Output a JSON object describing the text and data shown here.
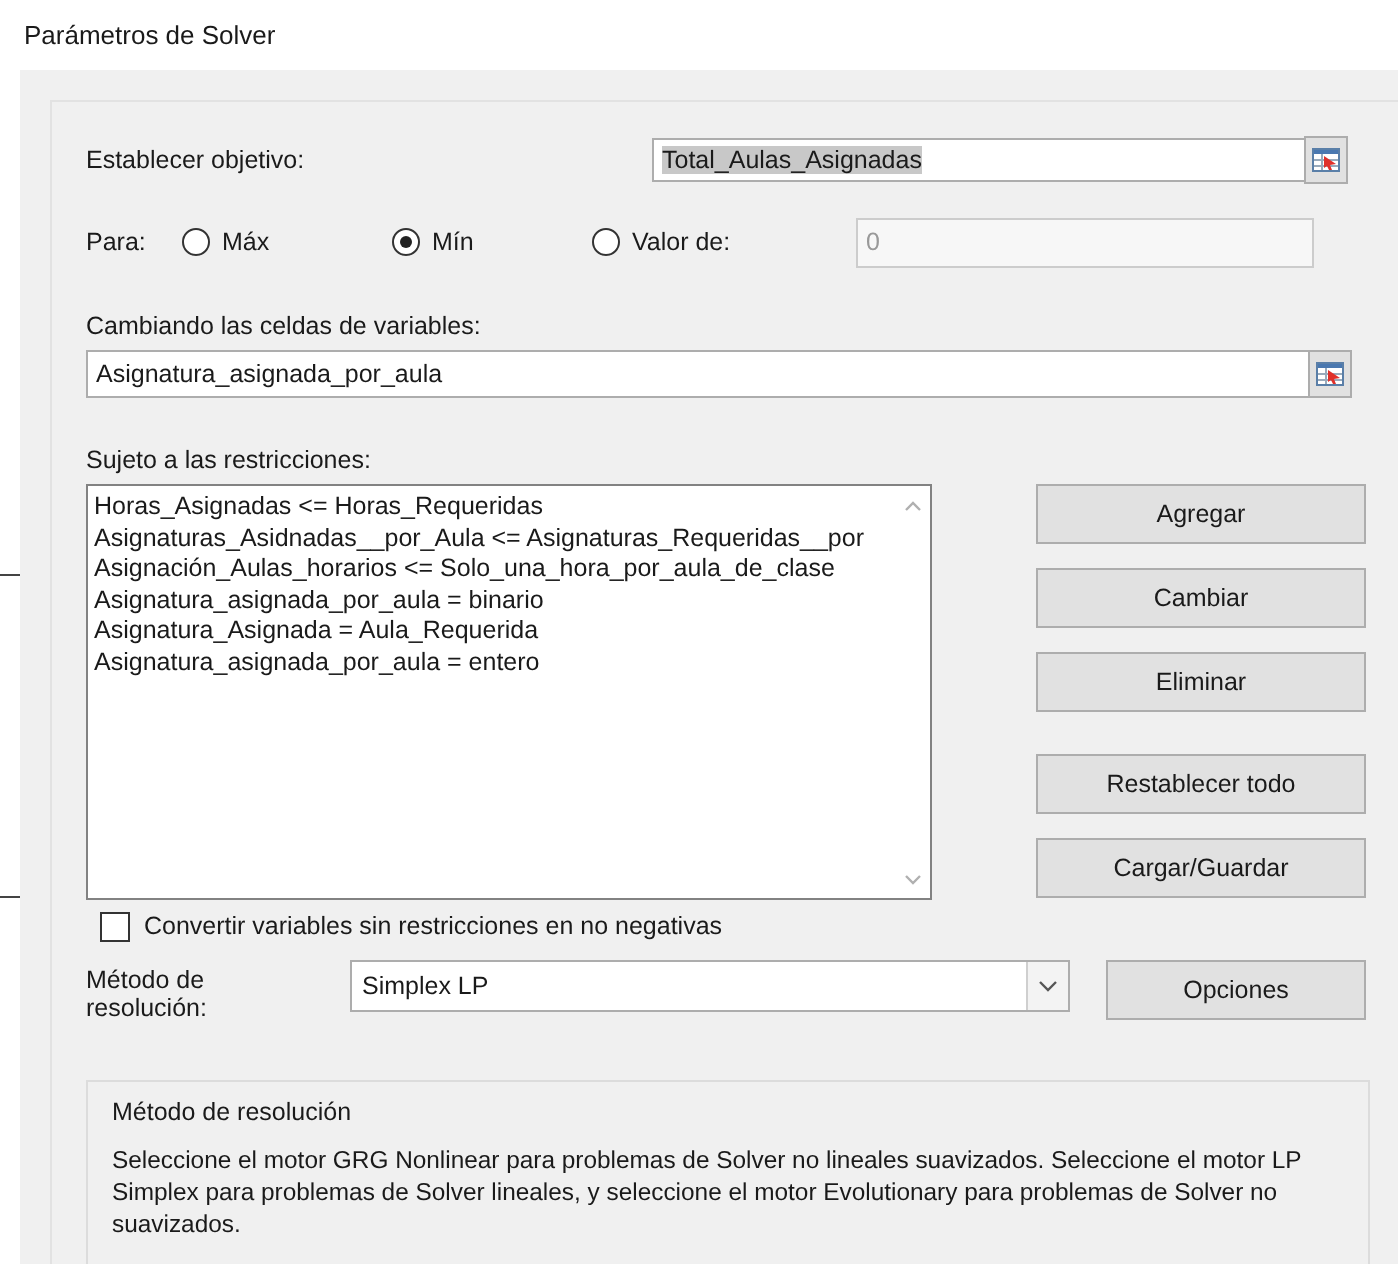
{
  "window": {
    "title": "Parámetros de Solver"
  },
  "objective": {
    "label": "Establecer objetivo:",
    "value": "Total_Aulas_Asignadas",
    "text_selected": true
  },
  "to": {
    "label": "Para:",
    "options": [
      {
        "label": "Máx",
        "selected": false
      },
      {
        "label": "Mín",
        "selected": true
      },
      {
        "label": "Valor de:",
        "selected": false
      }
    ],
    "value_field": {
      "value": "0",
      "disabled": true
    }
  },
  "variables": {
    "label": "Cambiando las celdas de variables:",
    "value": "Asignatura_asignada_por_aula"
  },
  "constraints": {
    "label": "Sujeto a las restricciones:",
    "items": [
      "Horas_Asignadas <= Horas_Requeridas",
      "Asignaturas_Asidnadas__por_Aula <= Asignaturas_Requeridas__por",
      "Asignación_Aulas_horarios <= Solo_una_hora_por_aula_de_clase",
      "Asignatura_asignada_por_aula = binario",
      "Asignatura_Asignada = Aula_Requerida",
      "Asignatura_asignada_por_aula = entero"
    ]
  },
  "buttons": [
    "Agregar",
    "Cambiar",
    "Eliminar",
    "Restablecer todo",
    "Cargar/Guardar"
  ],
  "nonnegative": {
    "label": "Convertir variables sin restricciones en no negativas",
    "checked": false
  },
  "method": {
    "label": "Método de resolución:",
    "value": "Simplex LP"
  },
  "options_button": "Opciones",
  "description": {
    "title": "Método de resolución",
    "text": "Seleccione el motor GRG Nonlinear para problemas de Solver no lineales suavizados. Seleccione el motor LP Simplex para problemas de Solver lineales, y seleccione el motor Evolutionary para problemas de Solver no suavizados."
  }
}
